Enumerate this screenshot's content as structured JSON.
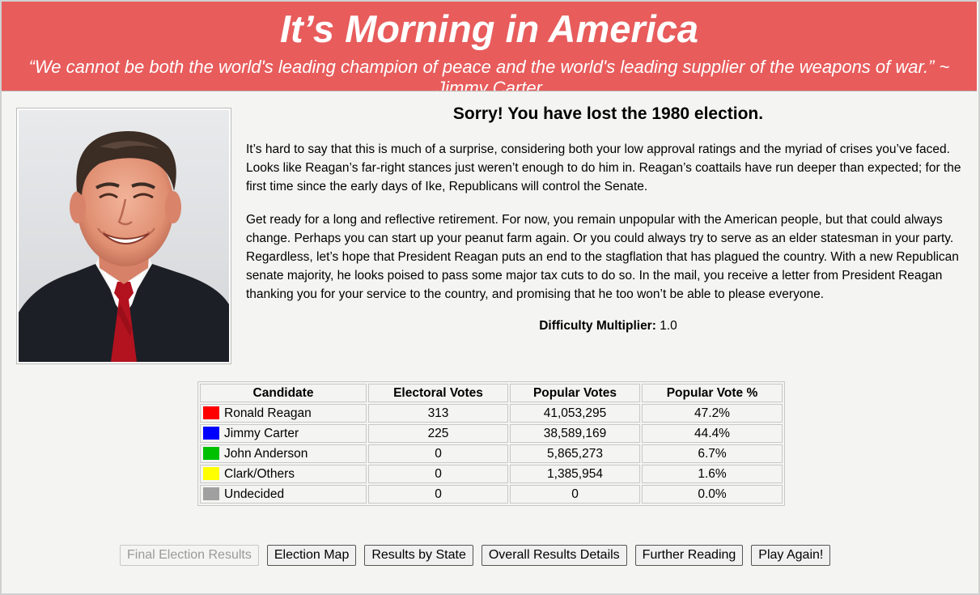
{
  "header": {
    "title": "It’s Morning in America",
    "quote": "“We cannot be both the world's leading champion of peace and the world's leading supplier of the weapons of war.” ~ Jimmy Carter"
  },
  "main": {
    "heading": "Sorry! You have lost the 1980 election.",
    "paragraph1": "It’s hard to say that this is much of a surprise, considering both your low approval ratings and the myriad of crises you’ve faced. Looks like Reagan’s far-right stances just weren’t enough to do him in. Reagan’s coattails have run deeper than expected; for the first time since the early days of Ike, Republicans will control the Senate.",
    "paragraph2": "Get ready for a long and reflective retirement. For now, you remain unpopular with the American people, but that could always change. Perhaps you can start up your peanut farm again. Or you could always try to serve as an elder statesman in your party. Regardless, let’s hope that President Reagan puts an end to the stagflation that has plagued the country. With a new Republican senate majority, he looks poised to pass some major tax cuts to do so. In the mail, you receive a letter from President Reagan thanking you for your service to the country, and promising that he too won’t be able to please everyone.",
    "difficulty_label": "Difficulty Multiplier:",
    "difficulty_value": "1.0"
  },
  "table": {
    "headers": [
      "Candidate",
      "Electoral Votes",
      "Popular Votes",
      "Popular Vote %"
    ],
    "rows": [
      {
        "name": "Ronald Reagan",
        "color": "#ff0000",
        "ev": "313",
        "pv": "41,053,295",
        "pct": "47.2%"
      },
      {
        "name": "Jimmy Carter",
        "color": "#0000ff",
        "ev": "225",
        "pv": "38,589,169",
        "pct": "44.4%"
      },
      {
        "name": "John Anderson",
        "color": "#00c000",
        "ev": "0",
        "pv": "5,865,273",
        "pct": "6.7%"
      },
      {
        "name": "Clark/Others",
        "color": "#ffff00",
        "ev": "0",
        "pv": "1,385,954",
        "pct": "1.6%"
      },
      {
        "name": "Undecided",
        "color": "#a0a0a0",
        "ev": "0",
        "pv": "0",
        "pct": "0.0%"
      }
    ]
  },
  "buttons": {
    "final_results": "Final Election Results",
    "election_map": "Election Map",
    "results_by_state": "Results by State",
    "overall_details": "Overall Results Details",
    "further_reading": "Further Reading",
    "play_again": "Play Again!"
  },
  "colors": {
    "header_bg": "#e85c5c",
    "page_bg": "#f4f4f2"
  }
}
